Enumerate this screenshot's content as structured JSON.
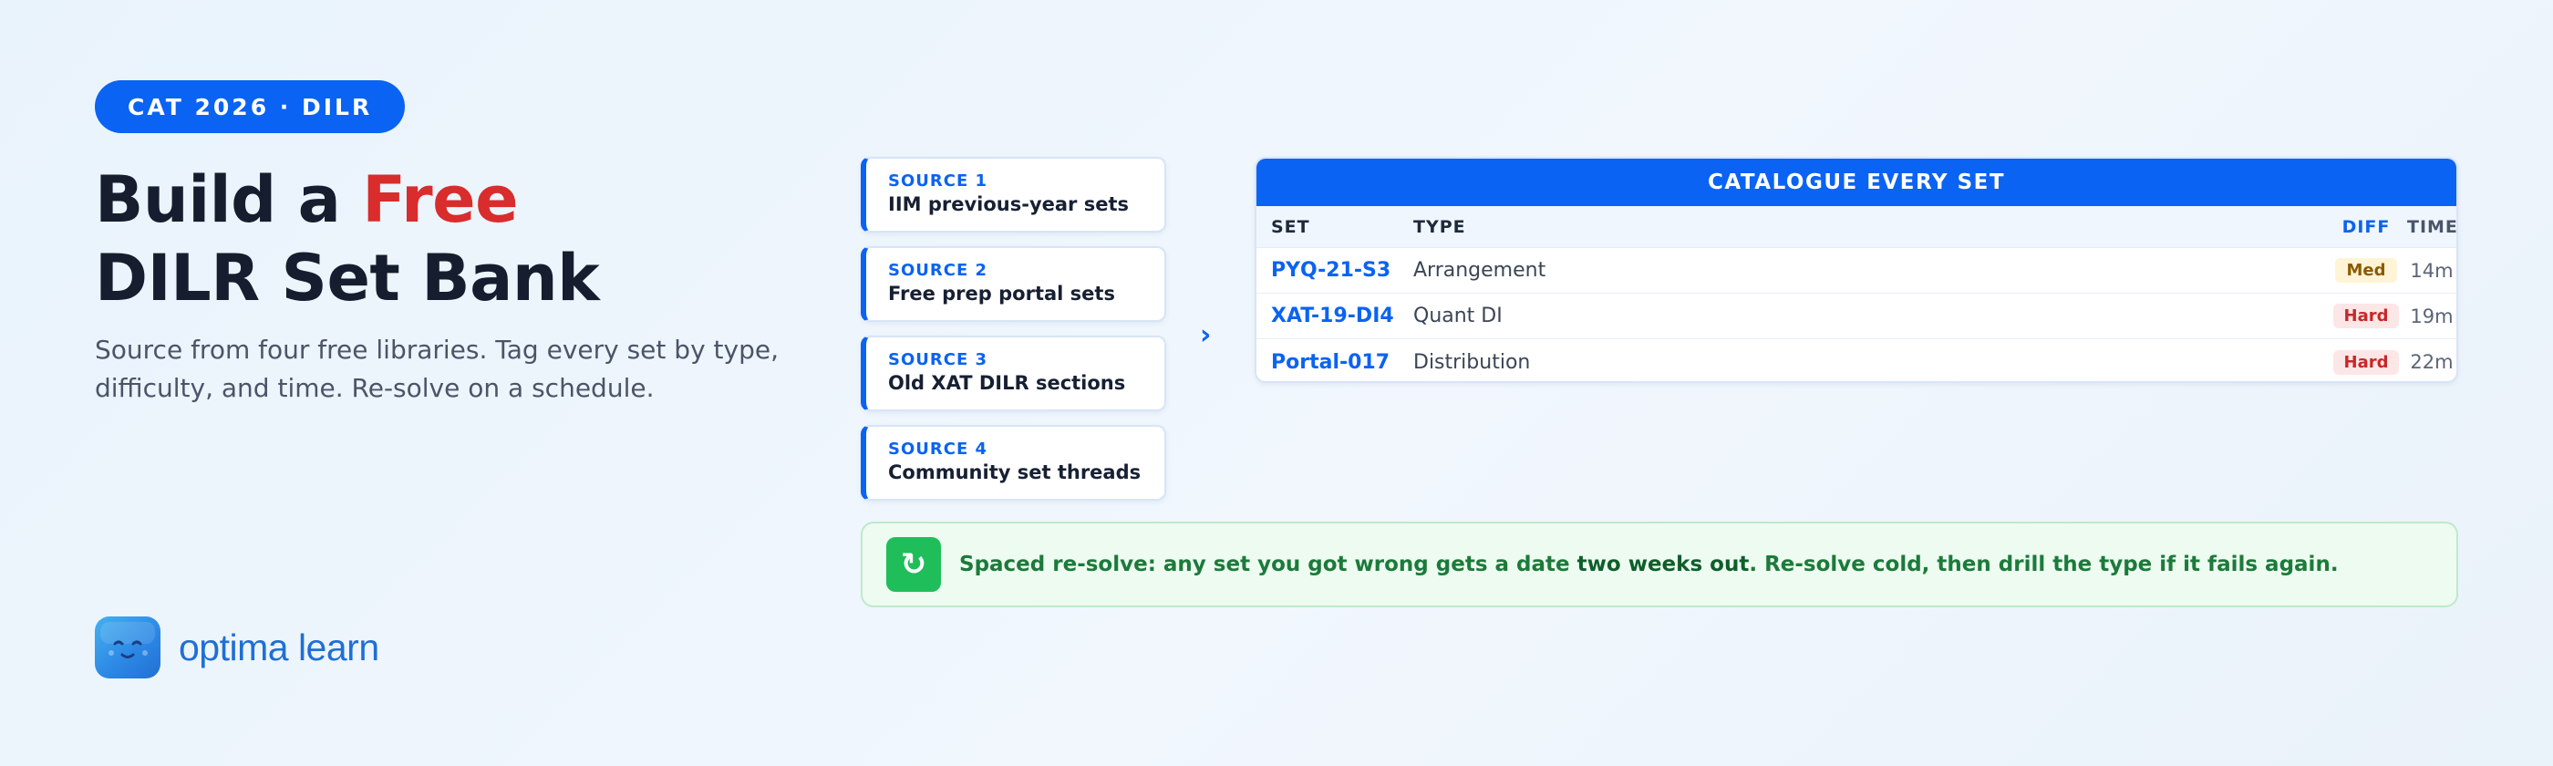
{
  "hero": {
    "pill": "CAT 2026 · DILR",
    "headline_pre": "Build a ",
    "headline_accent": "Free",
    "headline_line2": "DILR Set Bank",
    "lede": "Source from four free libraries. Tag every set by type, difficulty, and time. Re-solve on a schedule."
  },
  "brand": {
    "name": "optima learn",
    "logo_icon": "smiling-cube-icon"
  },
  "sources": [
    {
      "kicker": "SOURCE 1",
      "title": "IIM previous-year sets"
    },
    {
      "kicker": "SOURCE 2",
      "title": "Free prep portal sets"
    },
    {
      "kicker": "SOURCE 3",
      "title": "Old XAT DILR sections"
    },
    {
      "kicker": "SOURCE 4",
      "title": "Community set threads"
    }
  ],
  "arrow_icon": "chevron-right-icon",
  "catalogue": {
    "title": "CATALOGUE EVERY SET",
    "columns": {
      "set": "SET",
      "type": "TYPE",
      "diff": "DIFF",
      "time": "TIME"
    },
    "rows": [
      {
        "set": "PYQ-21-S3",
        "type": "Arrangement",
        "diff": "Med",
        "time": "14m"
      },
      {
        "set": "XAT-19-DI4",
        "type": "Quant DI",
        "diff": "Hard",
        "time": "19m"
      },
      {
        "set": "Portal-017",
        "type": "Distribution",
        "diff": "Hard",
        "time": "22m"
      }
    ]
  },
  "note": {
    "icon": "refresh-icon",
    "icon_glyph": "↻",
    "text_pre": "Spaced re-solve: any set you got wrong gets a date ",
    "text_strong": "two weeks out",
    "text_post": ". Re-solve cold, then drill the type if it fails again."
  },
  "colors": {
    "primary": "#0a63f2",
    "accent_red": "#d92c2c",
    "success": "#1fbe5a",
    "med_badge": "#fff4d6",
    "hard_badge": "#fde6e6"
  }
}
